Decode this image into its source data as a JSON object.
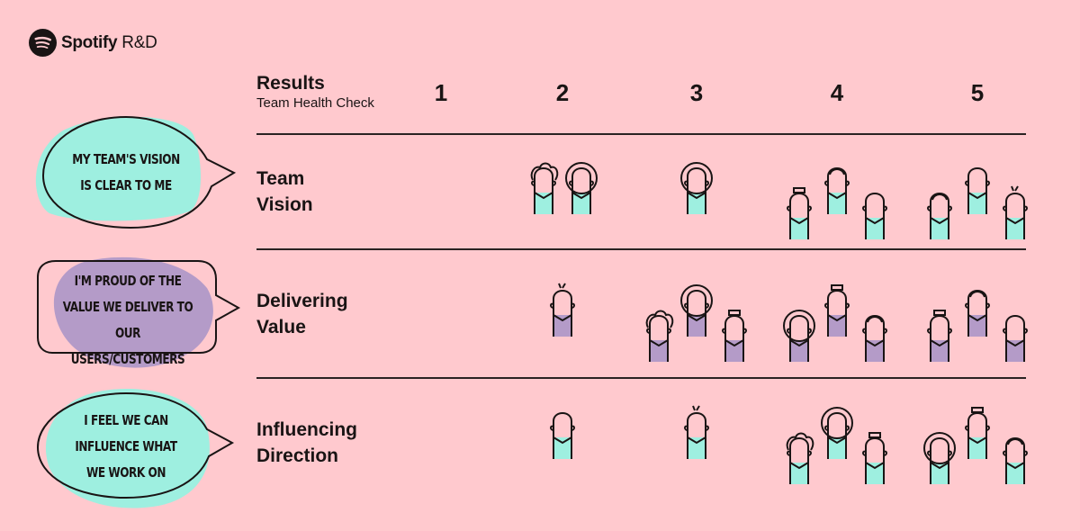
{
  "brand": {
    "name": "Spotify",
    "suffix": "R&D"
  },
  "header": {
    "title": "Results",
    "subtitle": "Team Health Check"
  },
  "scores": [
    "1",
    "2",
    "3",
    "4",
    "5"
  ],
  "colors": {
    "background": "#FFC9CE",
    "teal": "#9EEFE0",
    "purple": "#B49BC8",
    "ink": "#191414"
  },
  "rows": [
    {
      "label_line1": "Team",
      "label_line2": "Vision",
      "quote_lines": [
        "My team's vision",
        "is clear to me"
      ],
      "color": "teal",
      "bubble_shape": "oval",
      "votes": [
        0,
        2,
        1,
        3,
        3
      ]
    },
    {
      "label_line1": "Delivering",
      "label_line2": "Value",
      "quote_lines": [
        "I'm proud of the",
        "value we deliver to",
        "our users/customers"
      ],
      "color": "purple",
      "bubble_shape": "rounded-rectangle",
      "votes": [
        0,
        1,
        3,
        3,
        3
      ]
    },
    {
      "label_line1": "Influencing",
      "label_line2": "Direction",
      "quote_lines": [
        "I feel we can",
        "influence what",
        "we work on"
      ],
      "color": "teal",
      "bubble_shape": "oval",
      "votes": [
        0,
        1,
        1,
        3,
        3
      ]
    }
  ]
}
